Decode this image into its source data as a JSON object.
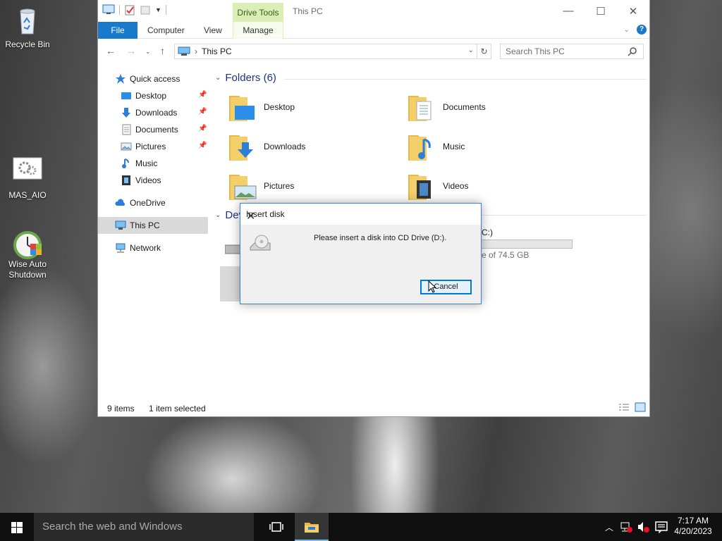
{
  "desktop": {
    "icons": [
      {
        "label": "Recycle Bin",
        "icon": "recycle-bin-icon"
      },
      {
        "label": "MAS_AIO",
        "icon": "gears-icon"
      },
      {
        "label": "Wise Auto Shutdown",
        "icon": "alarm-clock-icon"
      }
    ]
  },
  "explorer": {
    "title": "This PC",
    "context_tab": "Drive Tools",
    "tabs": [
      "File",
      "Computer",
      "View",
      "Manage"
    ],
    "address": "This PC",
    "search_placeholder": "Search This PC",
    "nav": {
      "quick_access": "Quick access",
      "items": [
        "Desktop",
        "Downloads",
        "Documents",
        "Pictures",
        "Music",
        "Videos"
      ],
      "onedrive": "OneDrive",
      "this_pc": "This PC",
      "network": "Network"
    },
    "folders_header": "Folders (6)",
    "folders": [
      "Desktop",
      "Documents",
      "Downloads",
      "Music",
      "Pictures",
      "Videos"
    ],
    "devices_header": "Dev",
    "drive_label_fragment": "C:)",
    "drive_space_fragment": "e of 74.5 GB",
    "status": {
      "items": "9 items",
      "selected": "1 item selected"
    }
  },
  "dialog": {
    "title": "Insert disk",
    "message": "Please insert a disk into CD Drive (D:).",
    "cancel": "Cancel"
  },
  "taskbar": {
    "search": "Search the web and Windows",
    "time": "7:17 AM",
    "date": "4/20/2023"
  },
  "colors": {
    "accent": "#1979ca",
    "drive_tools": "#d9efb6",
    "header_blue": "#1e3287",
    "taskbar": "#101010"
  }
}
